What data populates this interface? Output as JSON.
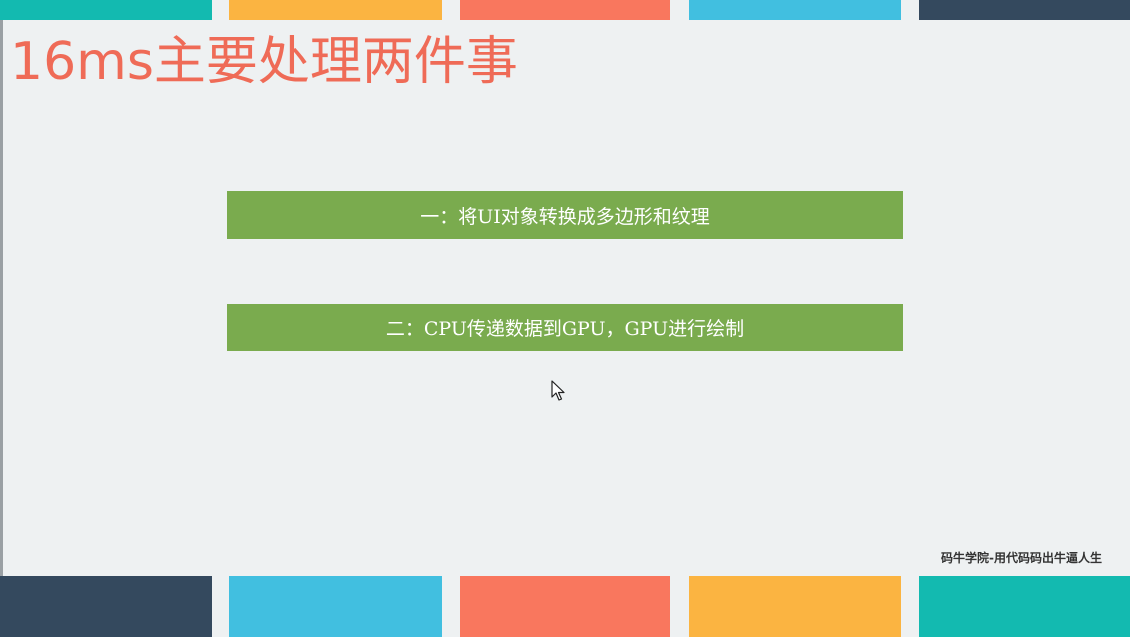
{
  "slide": {
    "title": "16ms主要处理两件事",
    "items": [
      {
        "label": "一：将UI对象转换成多边形和纹理"
      },
      {
        "label": "二：CPU传递数据到GPU，GPU进行绘制"
      }
    ],
    "watermark": "码牛学院-用代码码出牛逼人生"
  },
  "colors": {
    "background": "#eef1f2",
    "title": "#ef6b57",
    "item_box": "#7aab4e",
    "item_text": "#ffffff",
    "stripes_top": [
      "#13bab0",
      "#fbb441",
      "#f9775e",
      "#41bfe0",
      "#34495e"
    ],
    "stripes_bottom": [
      "#34495e",
      "#41bfe0",
      "#f9775e",
      "#fbb441",
      "#13bab0"
    ]
  },
  "icons": {
    "cursor": "mouse-pointer-icon"
  }
}
